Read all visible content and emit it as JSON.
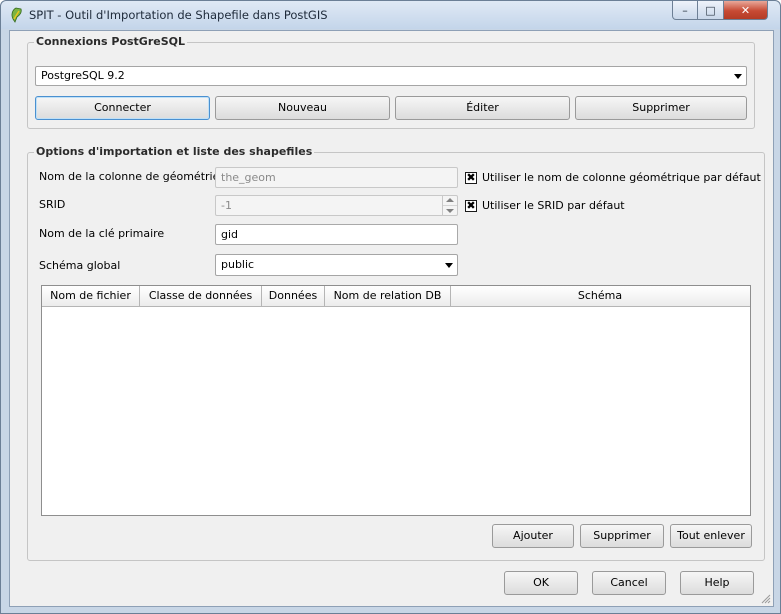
{
  "window": {
    "title": "SPIT - Outil d'Importation de Shapefile dans PostGIS",
    "controls": {
      "minimize": "–",
      "maximize": "□",
      "close": "✕"
    }
  },
  "connections": {
    "group_title": "Connexions PostGreSQL",
    "selected": "PostgreSQL 9.2",
    "buttons": {
      "connect": "Connecter",
      "new": "Nouveau",
      "edit": "Éditer",
      "delete": "Supprimer"
    }
  },
  "options": {
    "group_title": "Options d'importation et liste des shapefiles",
    "geom_column": {
      "label": "Nom de la colonne de géométrie",
      "value": "the_geom",
      "enabled": false
    },
    "srid": {
      "label": "SRID",
      "value": "-1",
      "enabled": false
    },
    "primary_key": {
      "label": "Nom de la clé primaire",
      "value": "gid"
    },
    "schema": {
      "label": "Schéma global",
      "value": "public"
    },
    "use_default_geom": {
      "label": "Utiliser le nom de colonne géométrique par défaut",
      "checked": true,
      "mark": "✖"
    },
    "use_default_srid": {
      "label": "Utiliser le SRID par défaut",
      "checked": true,
      "mark": "✖"
    },
    "table": {
      "columns": [
        "Nom de fichier",
        "Classe de données",
        "Données",
        "Nom de relation DB",
        "Schéma"
      ],
      "rows": []
    },
    "buttons": {
      "add": "Ajouter",
      "remove": "Supprimer",
      "remove_all": "Tout enlever"
    }
  },
  "dialog": {
    "ok": "OK",
    "cancel": "Cancel",
    "help": "Help"
  },
  "colors": {
    "titlebar": "#c4d5ea",
    "close_button": "#c74a34",
    "dialog_bg": "#f0f0f0"
  }
}
